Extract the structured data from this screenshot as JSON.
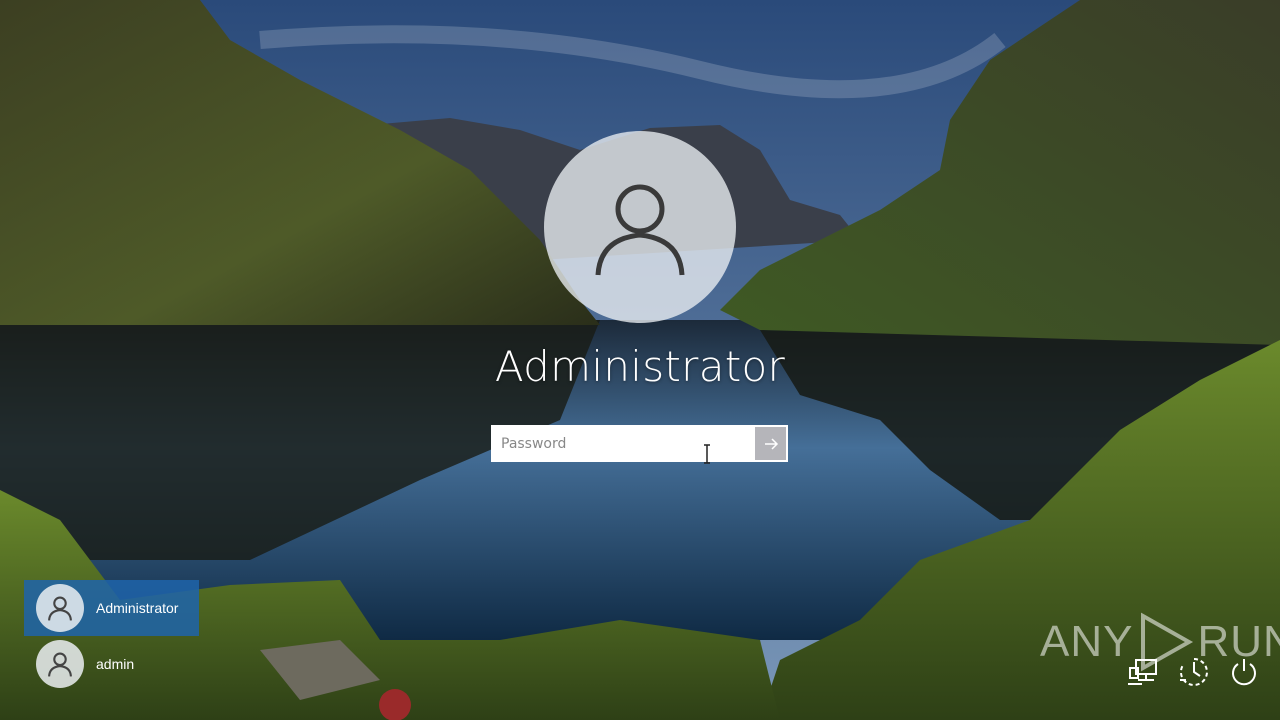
{
  "login": {
    "username": "Administrator",
    "password_placeholder": "Password",
    "submit_icon": "arrow-right-icon"
  },
  "users": [
    {
      "name": "Administrator",
      "selected": true
    },
    {
      "name": "admin",
      "selected": false
    }
  ],
  "watermark": {
    "left": "ANY",
    "right": "RUN"
  },
  "system_icons": [
    "network-icon",
    "accessibility-icon",
    "power-icon"
  ],
  "colors": {
    "selected_tile": "#1e64aa"
  }
}
